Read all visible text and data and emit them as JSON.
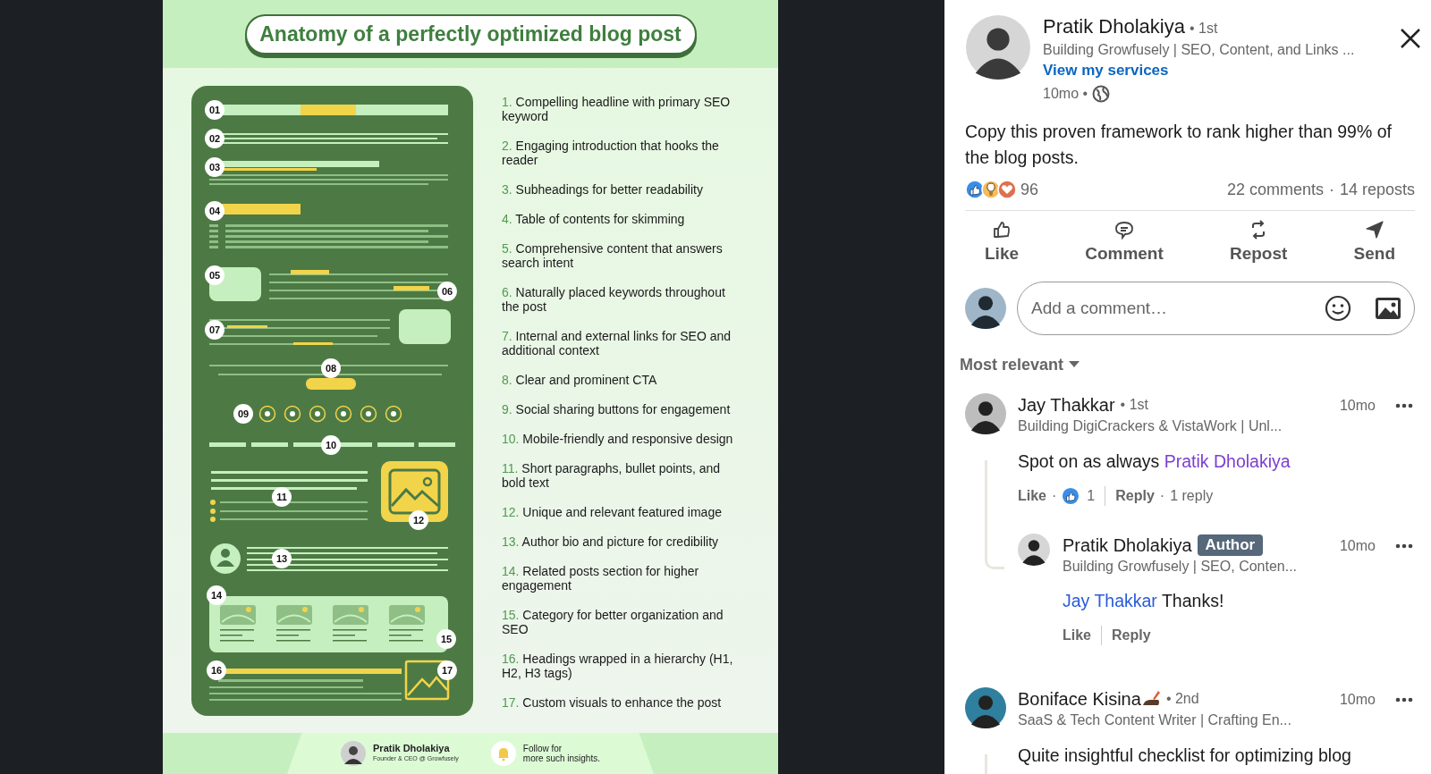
{
  "post_image": {
    "title": "Anatomy of a perfectly optimized blog post",
    "markers": [
      "01",
      "02",
      "03",
      "04",
      "05",
      "06",
      "07",
      "08",
      "09",
      "10",
      "11",
      "12",
      "13",
      "14",
      "15",
      "16",
      "17"
    ],
    "checklist": [
      {
        "number": "1.",
        "text": "Compelling headline with primary SEO keyword"
      },
      {
        "number": "2.",
        "text": "Engaging introduction that hooks the reader"
      },
      {
        "number": "3.",
        "text": "Subheadings for better readability"
      },
      {
        "number": "4.",
        "text": "Table of contents for skimming"
      },
      {
        "number": "5.",
        "text": "Comprehensive content that answers search intent"
      },
      {
        "number": "6.",
        "text": "Naturally placed keywords throughout the post"
      },
      {
        "number": "7.",
        "text": "Internal and external links for SEO and additional context"
      },
      {
        "number": "8.",
        "text": "Clear and prominent CTA"
      },
      {
        "number": "9.",
        "text": "Social sharing buttons for engagement"
      },
      {
        "number": "10.",
        "text": "Mobile-friendly and responsive design"
      },
      {
        "number": "11.",
        "text": "Short paragraphs, bullet points, and bold text"
      },
      {
        "number": "12.",
        "text": "Unique and relevant featured image"
      },
      {
        "number": "13.",
        "text": "Author bio and picture for credibility"
      },
      {
        "number": "14.",
        "text": "Related posts section for higher engagement"
      },
      {
        "number": "15.",
        "text": "Category for better organization and SEO"
      },
      {
        "number": "16.",
        "text": "Headings wrapped in a hierarchy (H1, H2, H3 tags)"
      },
      {
        "number": "17.",
        "text": "Custom visuals to enhance the post"
      }
    ],
    "footer": {
      "author_name": "Pratik Dholakiya",
      "author_role": "Founder & CEO @ Growfusely",
      "follow_lines": [
        "Follow for",
        "more such insights."
      ]
    }
  },
  "post": {
    "author": {
      "name": "Pratik Dholakiya",
      "degree": "• 1st",
      "headline": "Building Growfusely | SEO, Content, and Links ...",
      "services_link": "View my services",
      "time": "10mo •"
    },
    "text": "Copy this proven framework to rank higher than 99% of the blog posts.",
    "reactions_count": "96",
    "comments_count": "22 comments",
    "separator": "·",
    "reposts_count": "14 reposts"
  },
  "actions": [
    {
      "kind": "like",
      "label": "Like"
    },
    {
      "kind": "comment",
      "label": "Comment"
    },
    {
      "kind": "repost",
      "label": "Repost"
    },
    {
      "kind": "send",
      "label": "Send"
    }
  ],
  "comment_box": {
    "placeholder": "Add a comment…"
  },
  "sort": {
    "label": "Most relevant"
  },
  "comments": [
    {
      "name": "Jay Thakkar",
      "degree": "• 1st",
      "headline": "Building DigiCrackers & VistaWork | Unl...",
      "time": "10mo",
      "parts": [
        {
          "kind": "text",
          "text": "Spot on as always"
        },
        {
          "kind": "mention",
          "text": "Pratik Dholakiya",
          "visited": true
        }
      ],
      "like": "Like",
      "dot": "·",
      "like_count": "1",
      "reply": "Reply",
      "replies_count": "1 reply",
      "replies": [
        {
          "name": "Pratik Dholakiya",
          "badge": "Author",
          "headline": "Building Growfusely | SEO, Conten...",
          "time": "10mo",
          "parts": [
            {
              "kind": "mention",
              "text": "Jay Thakkar",
              "visited": false
            },
            {
              "kind": "text",
              "text": "Thanks!"
            }
          ],
          "like": "Like",
          "reply": "Reply"
        }
      ]
    },
    {
      "name": "Boniface Kisina",
      "degree": "• 2nd",
      "headline": "SaaS & Tech Content Writer | Crafting En...",
      "time": "10mo",
      "writing_emoji": true,
      "parts": [
        {
          "kind": "text",
          "text": "Quite insightful checklist for optimizing blog"
        }
      ]
    }
  ]
}
